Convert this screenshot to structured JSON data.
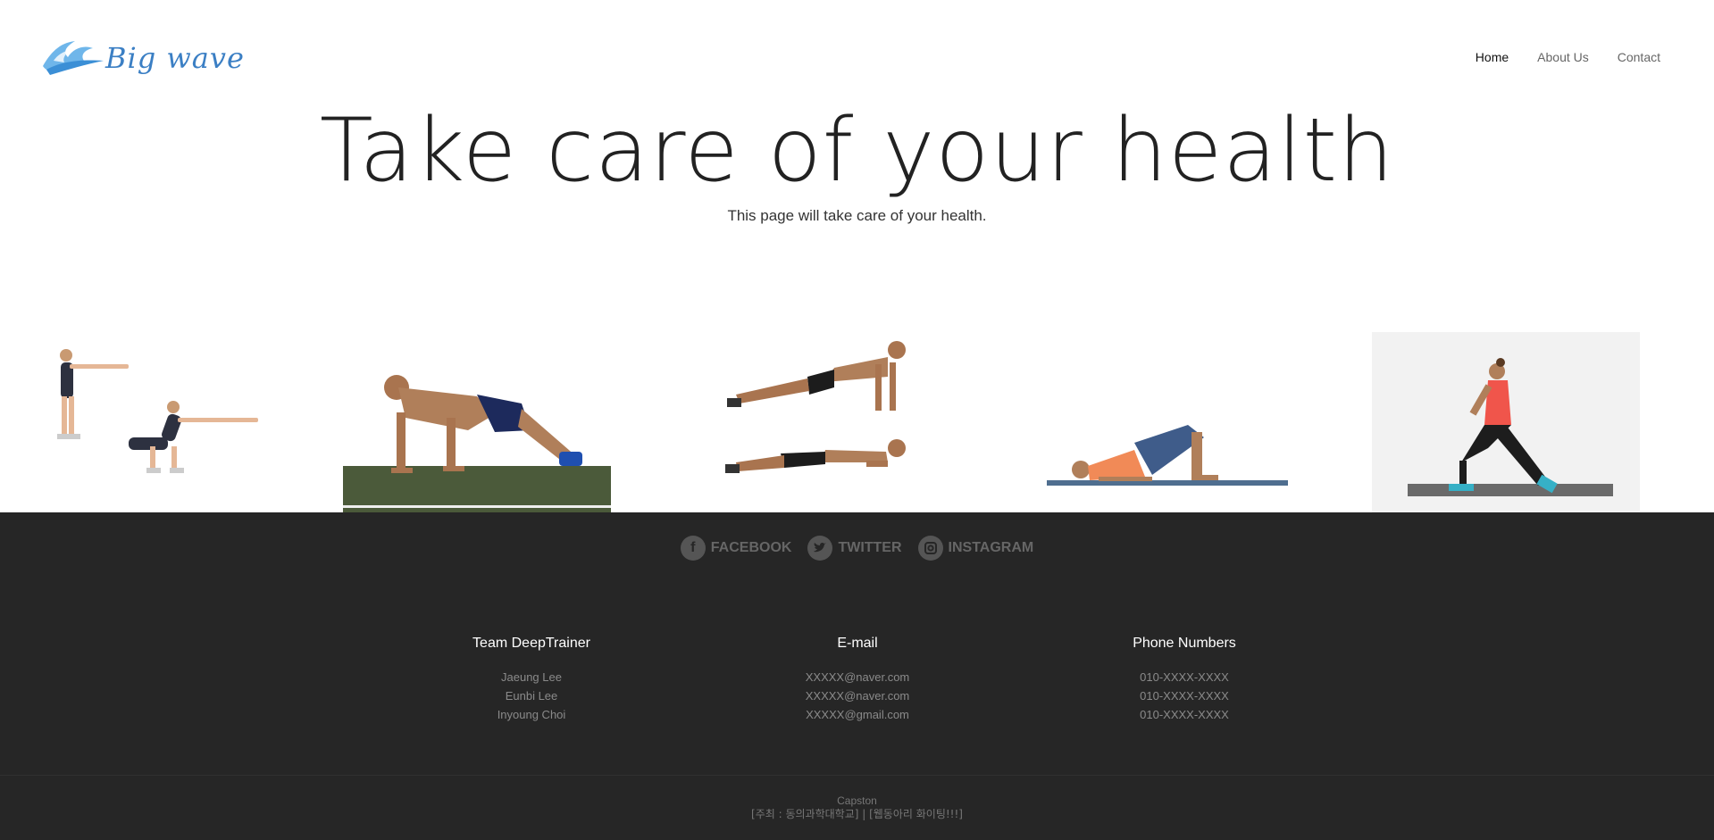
{
  "brand": {
    "logo_text": "Big wave"
  },
  "nav": {
    "items": [
      "Home",
      "About Us",
      "Contact"
    ]
  },
  "hero": {
    "title": "Take care of your health",
    "subtitle": "This page will take care of your health."
  },
  "social": [
    "FACEBOOK",
    "TWITTER",
    "INSTAGRAM"
  ],
  "footer": {
    "columns": [
      {
        "heading": "Team DeepTrainer",
        "lines": [
          "Jaeung Lee",
          "Eunbi Lee",
          "Inyoung Choi"
        ]
      },
      {
        "heading": "E-mail",
        "lines": [
          "XXXXX@naver.com",
          "XXXXX@naver.com",
          "XXXXX@gmail.com"
        ]
      },
      {
        "heading": "Phone Numbers",
        "lines": [
          "010-XXXX-XXXX",
          "010-XXXX-XXXX",
          "010-XXXX-XXXX"
        ]
      }
    ],
    "credit_line1": "Capston",
    "credit_line2": "[주최 : 동의과학대학교] | [웹동아리 화이팅!!!]"
  },
  "colors": {
    "footer_bg": "#262626",
    "logo_blue": "#3b7fc4"
  }
}
